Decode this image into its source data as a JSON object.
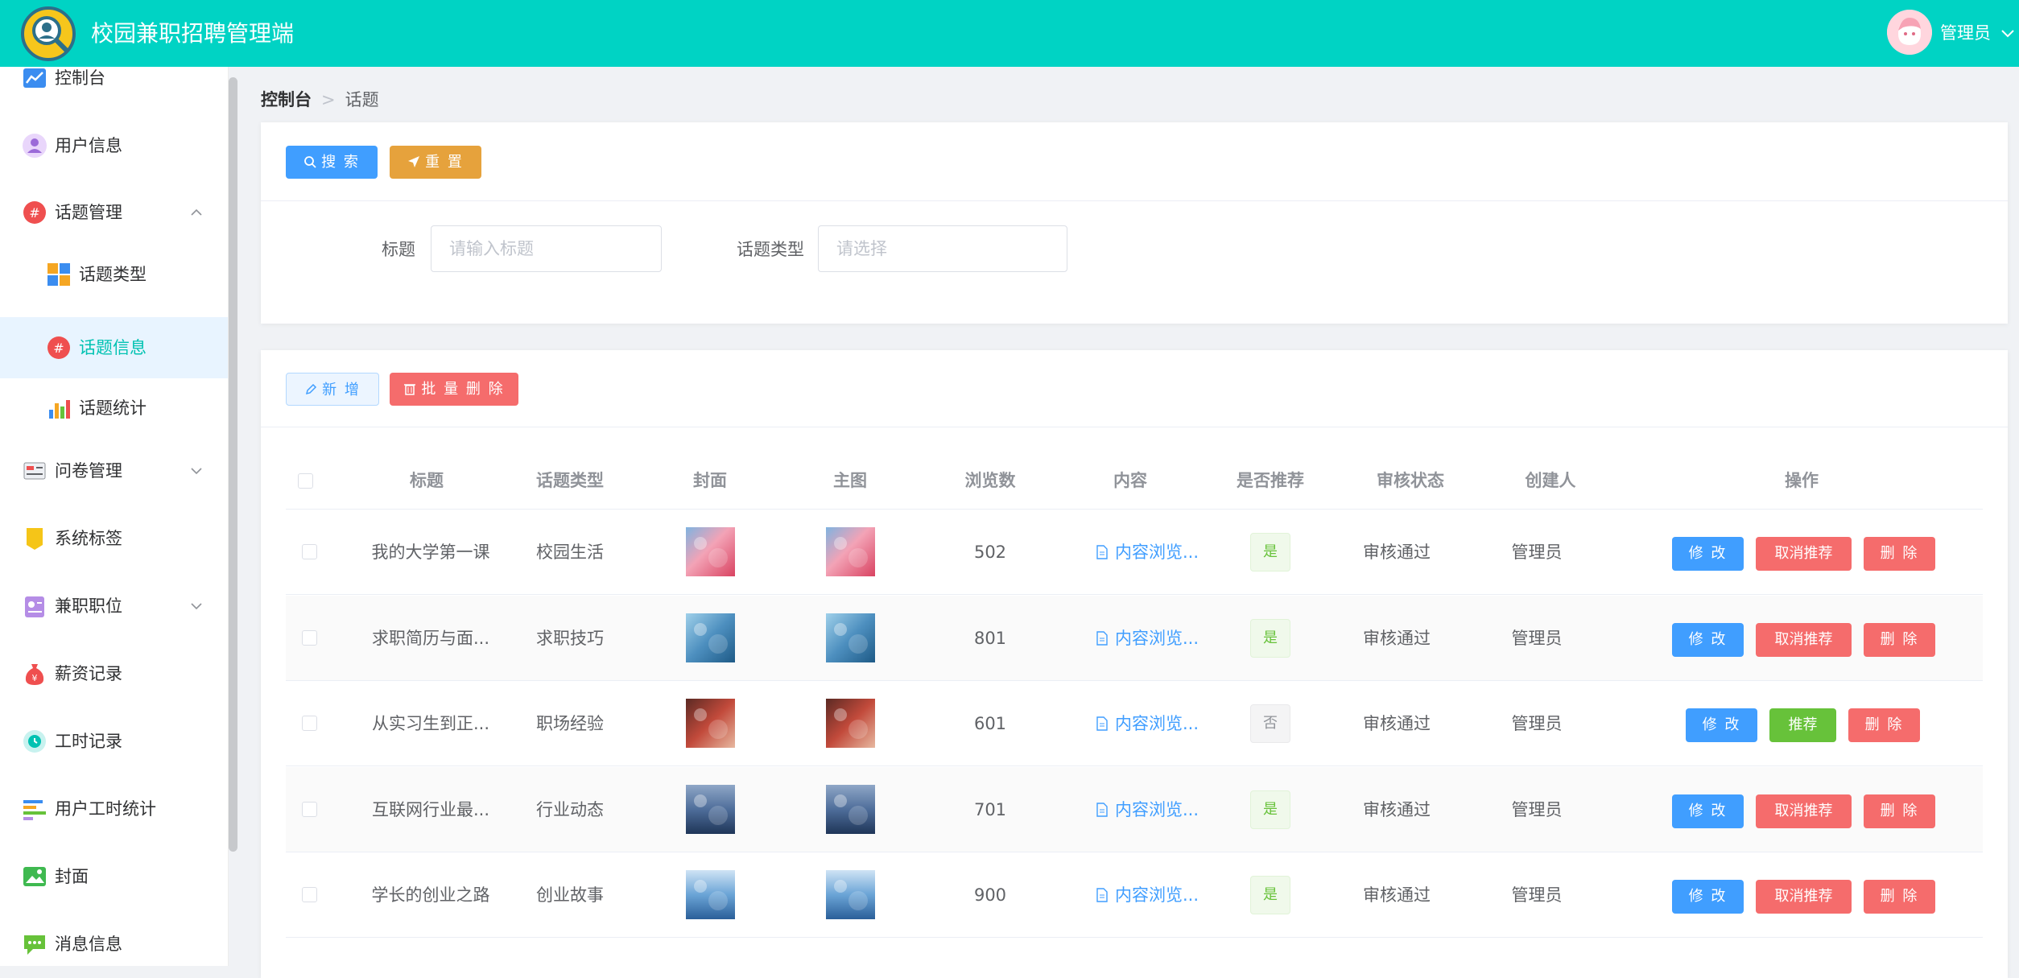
{
  "header": {
    "title": "校园兼职招聘管理端",
    "user_name": "管理员"
  },
  "sidebar": {
    "items": [
      {
        "label": "控制台",
        "icon": "line-chart-icon"
      },
      {
        "label": "用户信息",
        "icon": "user-icon"
      },
      {
        "label": "话题管理",
        "icon": "hashtag-icon",
        "expanded": true
      },
      {
        "label": "话题类型",
        "icon": "category-blocks-icon"
      },
      {
        "label": "话题信息",
        "icon": "hashtag-icon",
        "active": true
      },
      {
        "label": "话题统计",
        "icon": "bar-chart-icon"
      },
      {
        "label": "问卷管理",
        "icon": "survey-icon"
      },
      {
        "label": "系统标签",
        "icon": "tag-icon"
      },
      {
        "label": "兼职职位",
        "icon": "badge-icon"
      },
      {
        "label": "薪资记录",
        "icon": "money-bag-icon"
      },
      {
        "label": "工时记录",
        "icon": "clock-icon"
      },
      {
        "label": "用户工时统计",
        "icon": "bars-icon"
      },
      {
        "label": "封面",
        "icon": "image-icon"
      },
      {
        "label": "消息信息",
        "icon": "chat-icon"
      }
    ]
  },
  "breadcrumb": {
    "first": "控制台",
    "sep": ">",
    "current": "话题"
  },
  "search": {
    "search_label": "搜 索",
    "reset_label": "重 置",
    "title_label": "标题",
    "title_placeholder": "请输入标题",
    "type_label": "话题类型",
    "type_placeholder": "请选择"
  },
  "toolbar": {
    "add_label": "新 增",
    "batch_delete_label": "批 量 删 除"
  },
  "table": {
    "columns": [
      "标题",
      "话题类型",
      "封面",
      "主图",
      "浏览数",
      "内容",
      "是否推荐",
      "审核状态",
      "创建人",
      "操作"
    ],
    "rows": [
      {
        "title": "我的大学第一课",
        "type": "校园生活",
        "views": "502",
        "content": "内容浏览...",
        "recommended": "是",
        "status": "审核通过",
        "creator": "管理员",
        "img": "flowers",
        "actions": [
          "修 改",
          "取消推荐",
          "删 除"
        ]
      },
      {
        "title": "求职简历与面...",
        "type": "求职技巧",
        "views": "801",
        "content": "内容浏览...",
        "recommended": "是",
        "status": "审核通过",
        "creator": "管理员",
        "img": "blue-leaves",
        "actions": [
          "修 改",
          "取消推荐",
          "删 除"
        ]
      },
      {
        "title": "从实习生到正...",
        "type": "职场经验",
        "views": "601",
        "content": "内容浏览...",
        "recommended": "否",
        "status": "审核通过",
        "creator": "管理员",
        "img": "red-flowers",
        "actions": [
          "修 改",
          "推荐",
          "删 除"
        ]
      },
      {
        "title": "互联网行业最...",
        "type": "行业动态",
        "views": "701",
        "content": "内容浏览...",
        "recommended": "是",
        "status": "审核通过",
        "creator": "管理员",
        "img": "ocean",
        "actions": [
          "修 改",
          "取消推荐",
          "删 除"
        ]
      },
      {
        "title": "学长的创业之路",
        "type": "创业故事",
        "views": "900",
        "content": "内容浏览...",
        "recommended": "是",
        "status": "审核通过",
        "creator": "管理员",
        "img": "lake",
        "actions": [
          "修 改",
          "取消推荐",
          "删 除"
        ]
      }
    ]
  },
  "colors": {
    "primary": "#00d3c4",
    "blue": "#409eff",
    "orange": "#e6a23c",
    "red": "#f56c6c",
    "green": "#67c23a"
  }
}
